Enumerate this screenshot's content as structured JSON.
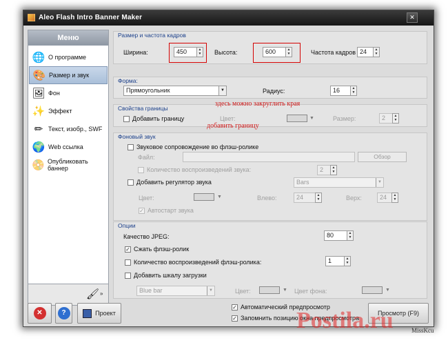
{
  "window": {
    "title": "Aleo Flash Intro Banner Maker"
  },
  "sidebar": {
    "header": "Меню",
    "items": [
      {
        "label": "О программе",
        "icon": "globe-icon"
      },
      {
        "label": "Размер и звук",
        "icon": "palette-icon"
      },
      {
        "label": "Фон",
        "icon": "background-image-icon"
      },
      {
        "label": "Эффект",
        "icon": "sparkle-icon"
      },
      {
        "label": "Текст, изобр., SWF",
        "icon": "pencil-text-icon"
      },
      {
        "label": "Web ссылка",
        "icon": "globe-link-icon"
      },
      {
        "label": "Опубликовать баннер",
        "icon": "publish-icon"
      }
    ],
    "active_index": 1
  },
  "size": {
    "title": "Размер и частота кадров",
    "width_label": "Ширина:",
    "width_value": "450",
    "height_label": "Высота:",
    "height_value": "600",
    "fps_label": "Частота кадров",
    "fps_value": "24"
  },
  "shape": {
    "title": "Форма:",
    "select_value": "Прямоугольник",
    "radius_label": "Радиус:",
    "radius_value": "16"
  },
  "border": {
    "title": "Свойства границы",
    "add_label": "Добавить границу",
    "color_label": "Цвет:",
    "size_label": "Размер:",
    "size_value": "2"
  },
  "annotations": {
    "round_corners": "здесь можно закруглить края",
    "add_border": "добавить границу"
  },
  "sound": {
    "title": "Фоновый звук",
    "sound_label": "Звуковое сопровождение во флэш-ролике",
    "file_label": "Файл:",
    "browse_label": "Обзор",
    "repeat_label": "Количество воспроизведений звука:",
    "repeat_value": "2",
    "volume_label": "Добавить регулятор звука",
    "bars_value": "Bars",
    "color_label": "Цвет:",
    "left_label": "Влево:",
    "left_value": "24",
    "top_label": "Верх:",
    "top_value": "24",
    "autostart_label": "Автостарт звука"
  },
  "options": {
    "title": "Опции",
    "jpeg_label": "Качество JPEG:",
    "jpeg_value": "80",
    "compress_label": "Сжать флэш-ролик",
    "playcount_label": "Количество воспроизведений флэш-ролика:",
    "playcount_value": "1",
    "loadbar_label": "Добавить шкалу загрузки",
    "bar_value": "Blue bar",
    "color_label": "Цвет:",
    "bg_color_label": "Цвет фона:"
  },
  "footer": {
    "project_label": "Проект",
    "auto_preview_label": "Автоматический предпросмотр",
    "remember_label": "Запомнить позицию окна предпросмотра",
    "preview_label": "Просмотр (F9)"
  },
  "watermark": {
    "site": "Postila.ru",
    "signature": "MissKcu"
  }
}
